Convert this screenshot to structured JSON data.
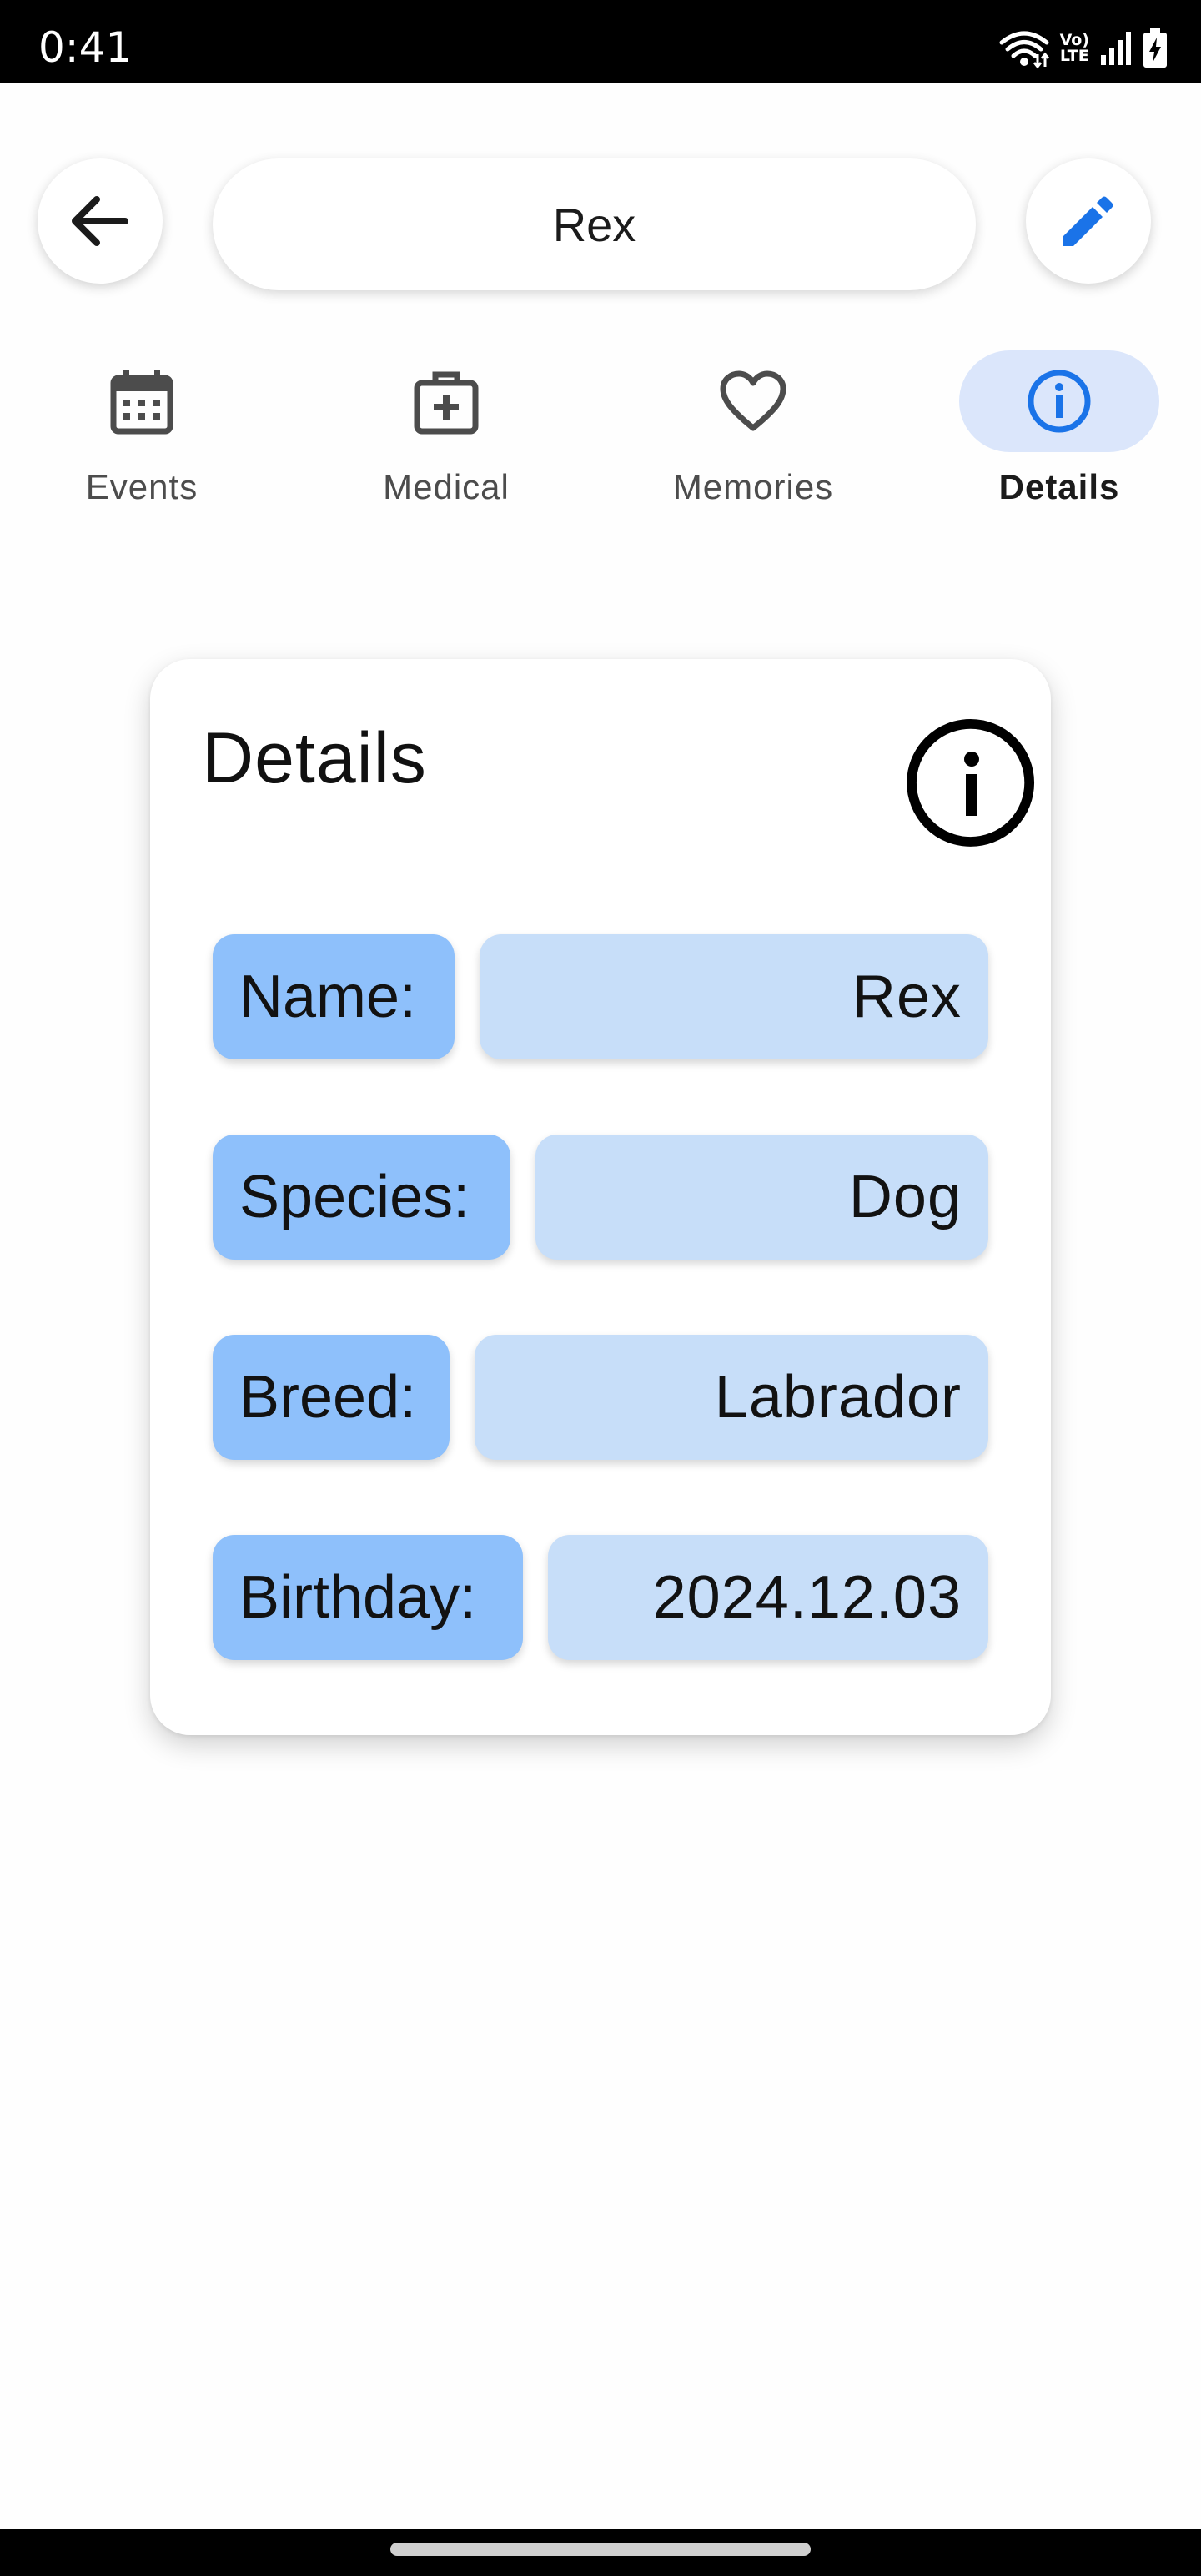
{
  "status_bar": {
    "time": "0:41",
    "lte_top": "Vo)",
    "lte_bottom": "LTE",
    "icons": [
      "wifi-icon",
      "volte-icon",
      "signal-icon",
      "battery-charging-icon"
    ]
  },
  "header": {
    "title": "Rex",
    "back_icon": "arrow-left-icon",
    "edit_icon": "pencil-icon"
  },
  "tabs": [
    {
      "label": "Events",
      "icon": "calendar-icon",
      "active": false
    },
    {
      "label": "Medical",
      "icon": "medical-kit-icon",
      "active": false
    },
    {
      "label": "Memories",
      "icon": "heart-icon",
      "active": false
    },
    {
      "label": "Details",
      "icon": "info-icon",
      "active": true
    }
  ],
  "details": {
    "title": "Details",
    "icon": "info-icon",
    "fields": [
      {
        "label": "Name:",
        "value": "Rex"
      },
      {
        "label": "Species:",
        "value": "Dog"
      },
      {
        "label": "Breed:",
        "value": "Labrador"
      },
      {
        "label": "Birthday:",
        "value": "2024.12.03"
      }
    ]
  },
  "colors": {
    "accent": "#1a73e8",
    "active_tab_bg": "#dbe6fb",
    "label_bg": "#8ec0fb",
    "value_bg": "#c7def9"
  }
}
